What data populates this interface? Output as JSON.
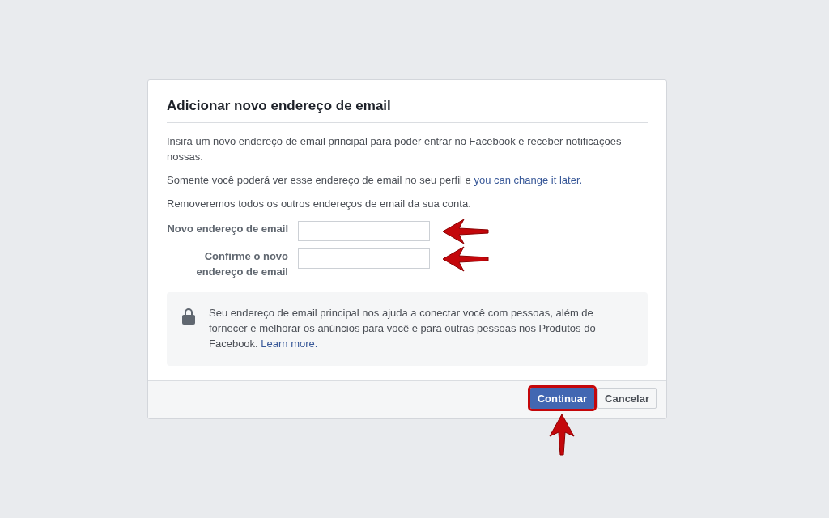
{
  "dialog": {
    "title": "Adicionar novo endereço de email",
    "paragraphs": [
      {
        "text": "Insira um novo endereço de email principal para poder entrar no Facebook e receber notificações nossas."
      },
      {
        "text": "Somente você poderá ver esse endereço de email no seu perfil e",
        "link": "you can change it later."
      },
      {
        "text": "Removeremos todos os outros endereços de email da sua conta."
      }
    ],
    "fields": [
      {
        "label": "Novo endereço de email",
        "highlighted": true
      },
      {
        "label": "Confirme o novo endereço de email",
        "highlighted": true
      }
    ],
    "notice": {
      "text": "Seu endereço de email principal nos ajuda a conectar você com pessoas, além de fornecer e melhorar os anúncios para você e para outras pessoas nos Produtos do Facebook.",
      "link": "Learn more."
    },
    "buttons": [
      {
        "label": "Continuar",
        "kind": "primary",
        "highlighted": true
      },
      {
        "label": "Cancelar",
        "kind": "secondary",
        "highlighted": false
      }
    ]
  }
}
